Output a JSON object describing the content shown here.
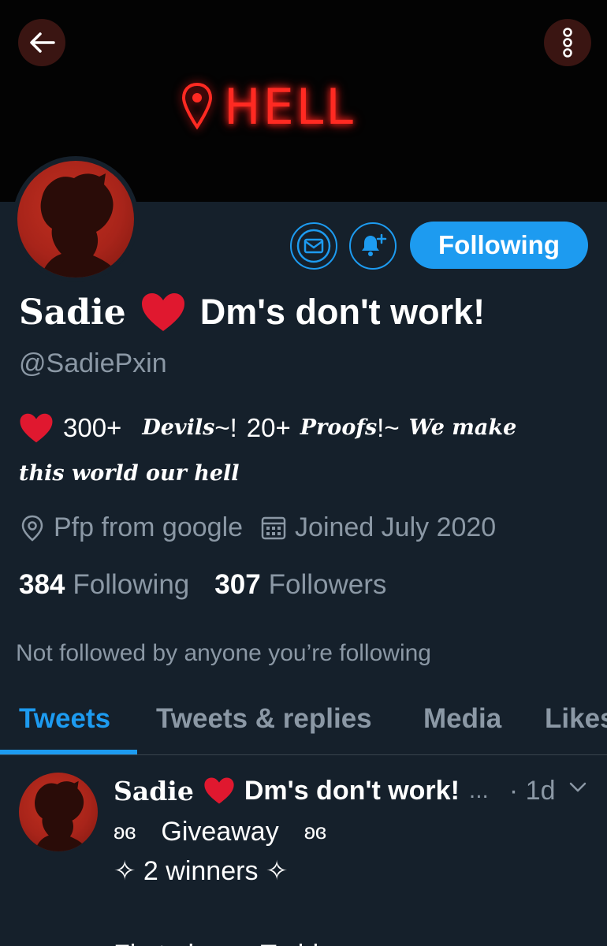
{
  "banner": {
    "text": "HELL"
  },
  "header": {
    "back_icon": "arrow-left-icon",
    "more_icon": "more-vertical-icon"
  },
  "actions": {
    "message_icon": "envelope-icon",
    "notify_icon": "bell-plus-icon",
    "following_label": "Following"
  },
  "profile": {
    "name_part1": "Sadie",
    "name_part2": "Dm's don't work!",
    "handle": "@SadiePxin",
    "bio": {
      "count1": "300+",
      "word1": "Devils",
      "tail1": "~!",
      "count2": "20+",
      "word2": "Proofs",
      "tail2": "!~",
      "phrase1": "We make",
      "phrase2": "this world our hell"
    },
    "location": "Pfp from google",
    "joined": "Joined July 2020",
    "following_count": "384",
    "following_label": "Following",
    "followers_count": "307",
    "followers_label": "Followers",
    "not_followed": "Not followed by anyone you’re following"
  },
  "tabs": [
    {
      "label": "Tweets",
      "active": true
    },
    {
      "label": "Tweets & replies",
      "active": false
    },
    {
      "label": "Media",
      "active": false
    },
    {
      "label": "Likes",
      "active": false
    }
  ],
  "tweet": {
    "name_part1": "Sadie",
    "name_part2": "Dm's don't work!",
    "ellipsis": "...",
    "time": "· 1d",
    "line1_symbol": "ʚɞ",
    "line1_text": "Giveaway",
    "line2": "✧ 2 winners ✧",
    "line3_partial": "First place - Teddy z"
  },
  "colors": {
    "accent": "#1d9bf0",
    "background": "#15202b",
    "heart": "#e0182f",
    "muted": "#8b98a5"
  }
}
